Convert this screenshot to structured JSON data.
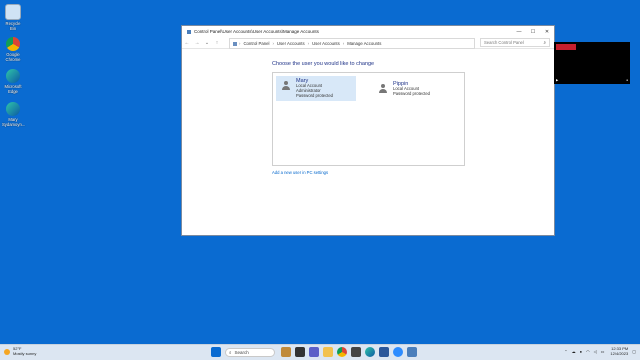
{
  "desktop": {
    "icons": [
      {
        "label": "Recycle Bin"
      },
      {
        "label": "Google Chrome"
      },
      {
        "label": "Microsoft Edge"
      },
      {
        "label": "Mary Sydamoyn..."
      }
    ]
  },
  "window": {
    "title": "Control Panel\\User Accounts\\User Accounts\\Manage Accounts",
    "controls": {
      "minimize": "—",
      "maximize": "☐",
      "close": "✕"
    },
    "nav": {
      "back": "←",
      "forward": "→",
      "down": "⌄",
      "up": "↑"
    },
    "breadcrumbs": [
      "Control Panel",
      "User Accounts",
      "User Accounts",
      "Manage Accounts"
    ],
    "breadcrumb_sep": "›",
    "search_placeholder": "Search Control Panel",
    "heading": "Choose the user you would like to change",
    "accounts": [
      {
        "name": "Mary",
        "details": [
          "Local Account",
          "Administrator",
          "Password protected"
        ],
        "selected": true
      },
      {
        "name": "Pippin",
        "details": [
          "Local Account",
          "Password protected"
        ],
        "selected": false
      }
    ],
    "add_user_link": "Add a new user in PC settings"
  },
  "taskbar": {
    "weather_temp": "52°F",
    "weather_desc": "Mostly sunny",
    "search_label": "Search",
    "clock_time": "12:33 PM",
    "clock_date": "12/4/2023"
  },
  "colors": {
    "desktop_bg": "#0a6bd1",
    "link": "#0066cc",
    "heading": "#1e3287",
    "selected_bg": "#d8e8f8"
  }
}
